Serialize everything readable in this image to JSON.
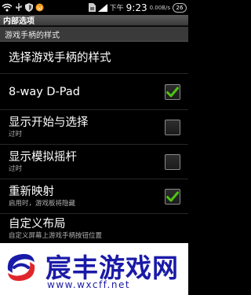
{
  "status_bar": {
    "icons": [
      "wifi-icon",
      "usb-icon",
      "shield-icon",
      "notification-icon",
      "sim-icon",
      "signal-icon"
    ],
    "period": "下午",
    "time": "9:23",
    "net_speed": "0.00B/s",
    "battery": "26"
  },
  "title_bar": {
    "title": "内部选项"
  },
  "section": {
    "header": "游戏手柄的样式"
  },
  "rows": [
    {
      "title": "选择游戏手柄的样式",
      "subtitle": "",
      "checkbox": false
    },
    {
      "title": "8-way D-Pad",
      "subtitle": "",
      "checkbox": true,
      "checked": true
    },
    {
      "title": "显示开始与选择",
      "subtitle": "过时",
      "checkbox": true,
      "checked": false
    },
    {
      "title": "显示模拟摇杆",
      "subtitle": "过时",
      "checkbox": true,
      "checked": false
    },
    {
      "title": "重新映射",
      "subtitle": "启用时，游戏板将隐藏",
      "checkbox": true,
      "checked": true
    },
    {
      "title": "自定义布局",
      "subtitle": "自定义屏幕上游戏手柄按钮位置",
      "checkbox": false
    }
  ],
  "watermark": {
    "brand": "宸丰游戏网",
    "url": "www.wxcff.net"
  },
  "colors": {
    "check": "#4cc414",
    "brand_blue": "#1a1aa8",
    "brand_red": "#e0262b"
  }
}
